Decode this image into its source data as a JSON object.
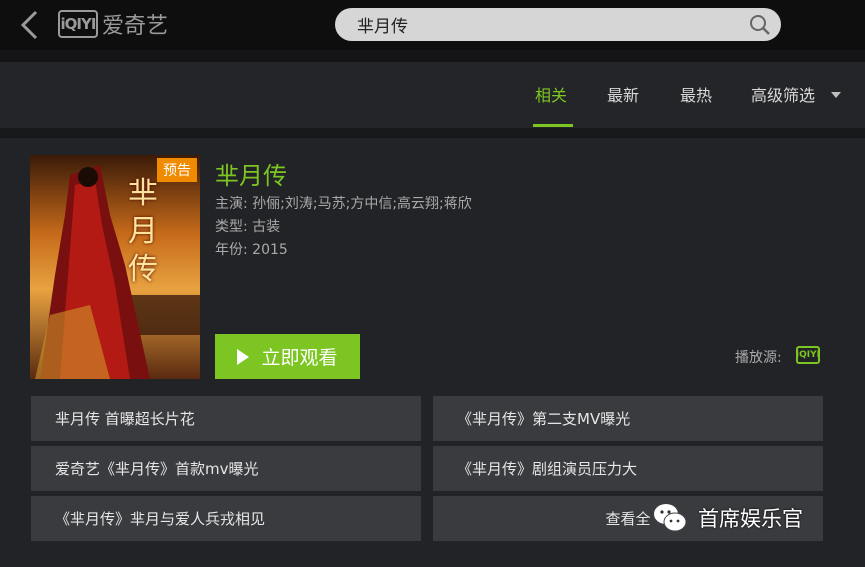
{
  "header": {
    "logo_mark": "iQIYI",
    "logo_text": "爱奇艺",
    "search_value": "芈月传"
  },
  "tabs": [
    {
      "label": "相关",
      "active": true
    },
    {
      "label": "最新",
      "active": false
    },
    {
      "label": "最热",
      "active": false
    },
    {
      "label": "高级筛选",
      "active": false
    }
  ],
  "show": {
    "badge": "预告",
    "poster_text": "芈月传",
    "title": "芈月传",
    "cast": "主演:  孙俪;刘涛;马苏;方中信;高云翔;蒋欣",
    "genre": "类型:  古装",
    "year": "年份:  2015",
    "watch_label": "立即观看",
    "source_label": "播放源:",
    "source_logo": "iQIYI"
  },
  "clips": [
    "芈月传 首曝超长片花",
    "《芈月传》第二支MV曝光",
    "爱奇艺《芈月传》首款mv曝光",
    "《芈月传》剧组演员压力大",
    "《芈月传》芈月与爱人兵戎相见",
    "查看全"
  ],
  "watermark": "首席娱乐官",
  "colors": {
    "accent": "#7cc522",
    "badge": "#f08a00"
  }
}
